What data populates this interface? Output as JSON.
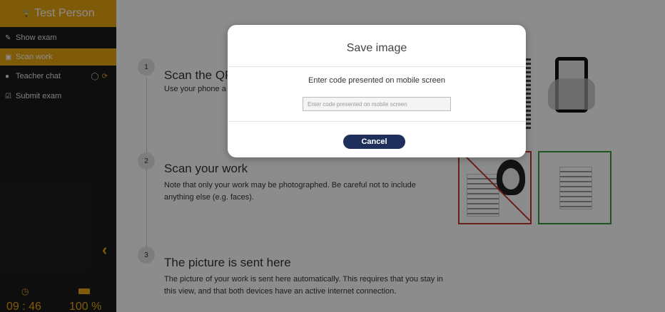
{
  "sidebar": {
    "user_name": "Test Person",
    "items": [
      {
        "label": "Show exam",
        "icon": "edit-icon"
      },
      {
        "label": "Scan work",
        "icon": "camera-icon",
        "active": true
      },
      {
        "label": "Teacher chat",
        "icon": "chat-icon"
      },
      {
        "label": "Submit exam",
        "icon": "checkbox-icon"
      }
    ],
    "time": "09 : 46",
    "battery": "100 %"
  },
  "steps": [
    {
      "number": "1",
      "title": "Scan the QR",
      "description": "Use your phone a"
    },
    {
      "number": "2",
      "title": "Scan your work",
      "description": "Note that only your work may be photographed. Be careful not to include anything else (e.g. faces)."
    },
    {
      "number": "3",
      "title": "The picture is sent here",
      "description": "The picture of your work is sent here automatically. This requires that you stay in this view, and that both devices have an active internet connection."
    }
  ],
  "modal": {
    "title": "Save image",
    "prompt": "Enter code presented on mobile screen",
    "input_placeholder": "Enter code presented on mobile screen",
    "input_value": "",
    "cancel_label": "Cancel"
  },
  "colors": {
    "accent": "#e8a50f",
    "sidebar_bg": "#1b1b1b",
    "cancel_button": "#1d2f5a",
    "bad_example": "#c0392b",
    "good_example": "#3a9b3a"
  }
}
